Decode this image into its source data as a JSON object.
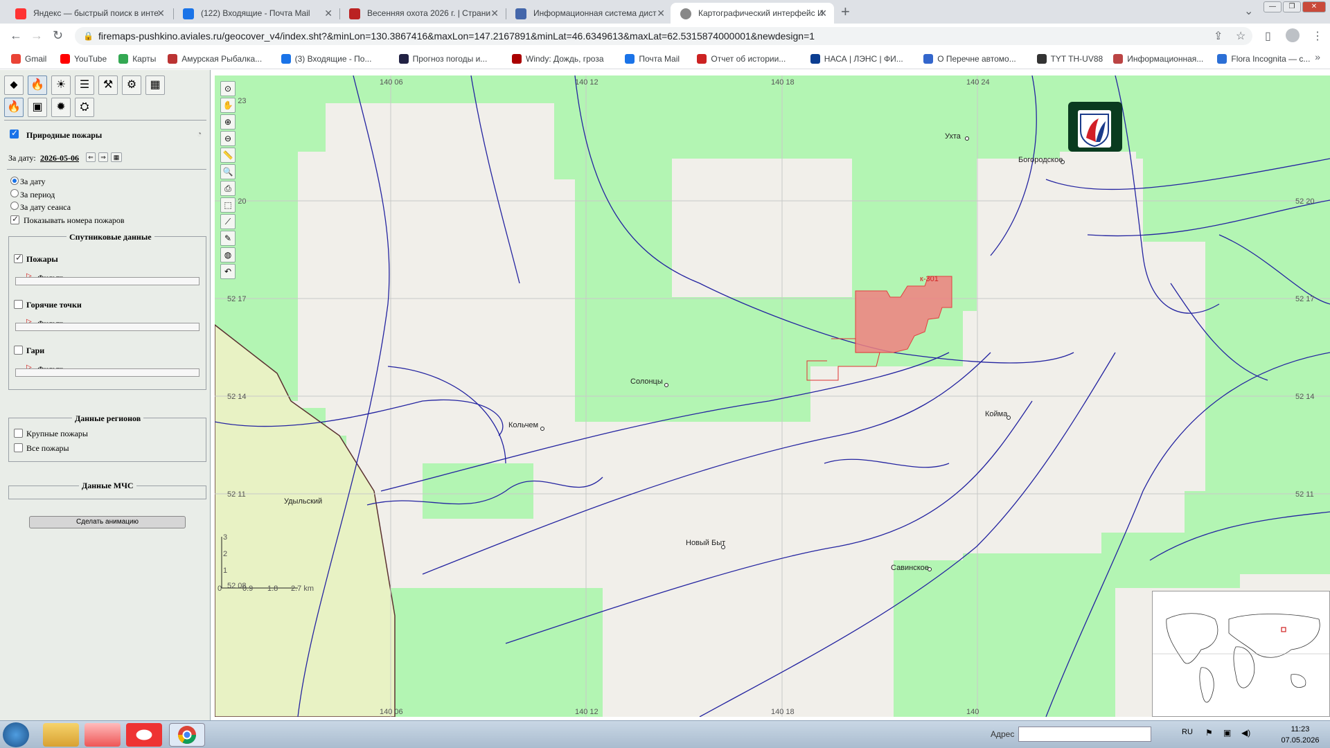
{
  "browser": {
    "tabs": [
      {
        "title": "Яндекс — быстрый поиск в инте",
        "color": "#f33"
      },
      {
        "title": "(122) Входящие - Почта Mail",
        "color": "#1a73e8"
      },
      {
        "title": "Весенняя охота 2026 г. | Страни",
        "color": "#b22"
      },
      {
        "title": "Информационная система дист",
        "color": "#4466aa"
      },
      {
        "title": "Картографический интерфейс И",
        "color": "#888"
      }
    ],
    "url": "firemaps-pushkino.aviales.ru/geocover_v4/index.sht?&minLon=130.3867416&maxLon=147.2167891&minLat=46.6349613&maxLat=62.5315874000001&newdesign=1",
    "bookmarks": [
      {
        "label": "Gmail",
        "color": "#ea4335"
      },
      {
        "label": "YouTube",
        "color": "#ff0000"
      },
      {
        "label": "Карты",
        "color": "#34a853"
      },
      {
        "label": "Амурская Рыбалка...",
        "color": "#b33"
      },
      {
        "label": "(3) Входящие - По...",
        "color": "#1a73e8"
      },
      {
        "label": "Прогноз погоды и...",
        "color": "#224"
      },
      {
        "label": "Windy: Дождь, гроза",
        "color": "#a00"
      },
      {
        "label": "Почта Mail",
        "color": "#1a73e8"
      },
      {
        "label": "Отчет об истории...",
        "color": "#c22"
      },
      {
        "label": "НАСА | ЛЭНС | ФИ...",
        "color": "#0b3d91"
      },
      {
        "label": "О Перечне автомо...",
        "color": "#36c"
      },
      {
        "label": "TYT TH-UV88",
        "color": "#333"
      },
      {
        "label": "Информационная...",
        "color": "#b44"
      },
      {
        "label": "Flora Incognita — с...",
        "color": "#2b6fd6"
      }
    ]
  },
  "panel": {
    "section_title": "Природные пожары",
    "date_label": "За дату:",
    "date_value": "2026-05-06",
    "radio_options": [
      "За дату",
      "За период",
      "За дату сеанса"
    ],
    "show_numbers": "Показывать номера пожаров",
    "satellite_title": "Спутниковые данные",
    "layers": [
      {
        "label": "Пожары",
        "filter": "Фильтр",
        "checked": true
      },
      {
        "label": "Горячие точки",
        "filter": "Фильтр",
        "checked": false
      },
      {
        "label": "Гари",
        "filter": "Фильтр",
        "checked": false
      }
    ],
    "regions_title": "Данные регионов",
    "region_options": [
      "Крупные пожары",
      "Все пожары"
    ],
    "mchs_title": "Данные МЧС",
    "animate_button": "Сделать анимацию"
  },
  "map": {
    "lon_labels": [
      "140 06",
      "140 12",
      "140 18",
      "140 24"
    ],
    "lon_labels_bottom": [
      "140 06",
      "140 12",
      "140 18",
      "140"
    ],
    "lat_labels": [
      "52 20",
      "52 17",
      "52 14",
      "52 11"
    ],
    "lat_corner": "52 23",
    "places": [
      "Ухта",
      "Богородское",
      "Солонцы",
      "Кольчем",
      "Койма",
      "Удыльский",
      "Новый Быт",
      "Савинское"
    ],
    "fire_label": "к-301",
    "scale_labels": [
      "0",
      "0.9",
      "1.8",
      "2.7 km"
    ],
    "scale_vert": [
      "3",
      "2",
      "1"
    ],
    "corner_text": "52 08",
    "colors": {
      "forest": "#b3f5b3",
      "land": "#f1efea",
      "river": "#2323a0",
      "fire": "#f08080",
      "reserve": "#e8f2c4"
    }
  },
  "taskbar": {
    "address_label": "Адрес",
    "lang": "RU",
    "time": "11:23",
    "date": "07.05.2026"
  }
}
